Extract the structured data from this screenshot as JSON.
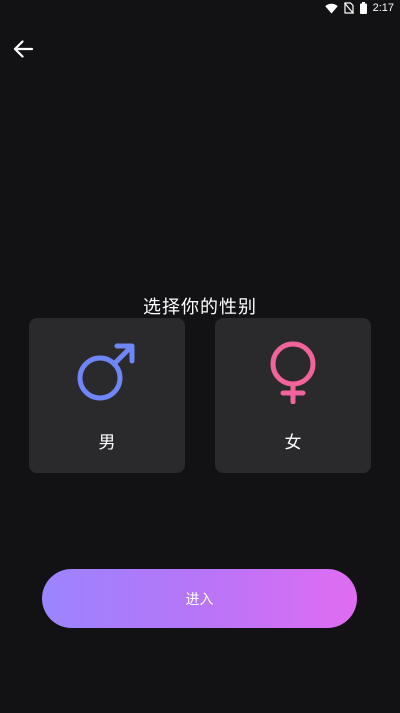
{
  "status_bar": {
    "time": "2:17",
    "icons": [
      "wifi-icon",
      "no-sim-icon",
      "battery-icon"
    ]
  },
  "header": {
    "back_icon": "arrow-left-icon"
  },
  "main": {
    "title": "选择你的性别",
    "options": [
      {
        "label": "男",
        "icon": "male-symbol-icon",
        "color": "#6f86f7"
      },
      {
        "label": "女",
        "icon": "female-symbol-icon",
        "color": "#f0649b"
      }
    ],
    "enter_label": "进入"
  },
  "colors": {
    "background": "#121214",
    "card": "#2a2a2d",
    "button_gradient_start": "#9b84ff",
    "button_gradient_end": "#e06cf2"
  }
}
